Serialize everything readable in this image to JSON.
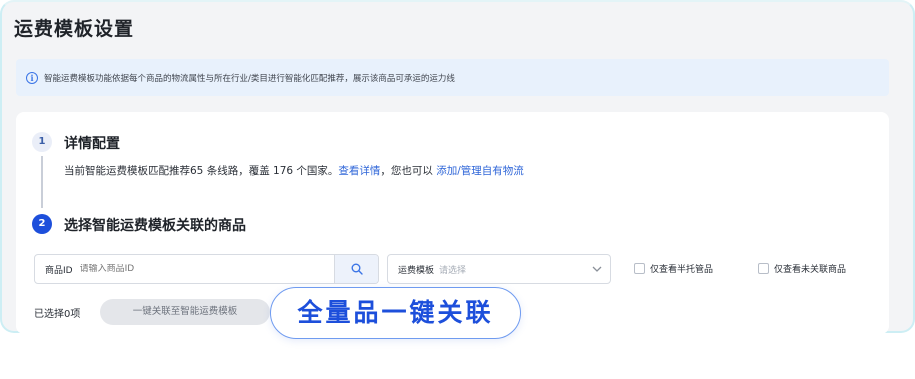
{
  "page": {
    "title": "运费模板设置"
  },
  "notice": {
    "icon": "info-icon",
    "text": "智能运费模板功能依据每个商品的物流属性与所在行业/类目进行智能化匹配推荐，展示该商品可承运的运力线"
  },
  "steps": [
    {
      "number": "1",
      "title": "详情配置",
      "desc_prefix": "当前智能运费模板匹配推荐65 条线路，覆盖 176 个国家。",
      "link_details": "查看详情",
      "desc_middle": "，您也可以 ",
      "link_manage": "添加/管理自有物流"
    },
    {
      "number": "2",
      "title": "选择智能运费模板关联的商品"
    }
  ],
  "filters": {
    "search_label": "商品ID",
    "search_placeholder": "请输入商品ID",
    "search_icon": "search-icon",
    "template_label": "运费模板",
    "template_placeholder": "请选择",
    "checkbox_semi_managed": "仅查看半托管品",
    "checkbox_unlinked": "仅查看未关联商品"
  },
  "actions": {
    "selected_count": "已选择0项",
    "bulk_link_button": "一键关联至智能运费模板"
  },
  "callout": {
    "text": "全量品一键关联"
  },
  "colors": {
    "accent": "#1d4fdb",
    "link": "#2f66d8",
    "notice_bg": "#e8f1fc"
  }
}
